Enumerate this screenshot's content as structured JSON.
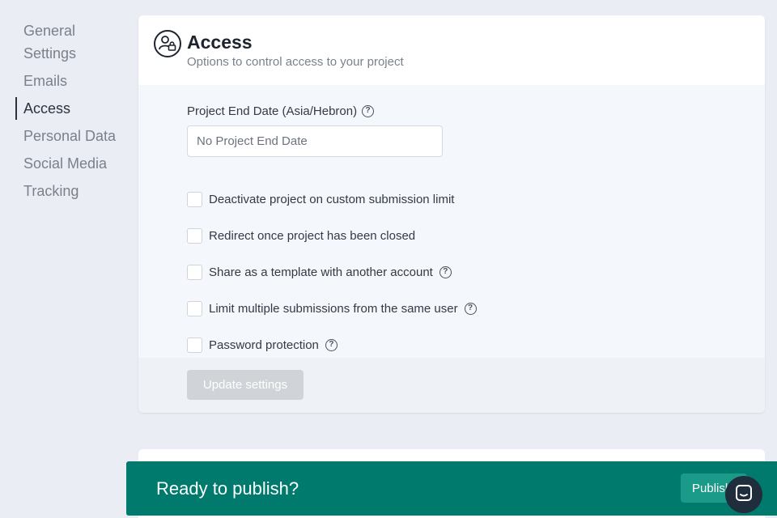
{
  "sidebar": {
    "items": [
      {
        "label": "General Settings"
      },
      {
        "label": "Emails"
      },
      {
        "label": "Access",
        "active": true
      },
      {
        "label": "Personal Data"
      },
      {
        "label": "Social Media"
      },
      {
        "label": "Tracking"
      }
    ]
  },
  "access": {
    "icon": "user-lock-icon",
    "title": "Access",
    "subtitle": "Options to control access to your project",
    "end_date": {
      "label": "Project End Date (Asia/Hebron)",
      "placeholder": "No Project End Date",
      "value": ""
    },
    "options": [
      {
        "label": "Deactivate project on custom submission limit",
        "checked": false,
        "help": false
      },
      {
        "label": "Redirect once project has been closed",
        "checked": false,
        "help": false
      },
      {
        "label": "Share as a template with another account",
        "checked": false,
        "help": true
      },
      {
        "label": "Limit multiple submissions from the same user",
        "checked": false,
        "help": true
      },
      {
        "label": "Password protection",
        "checked": false,
        "help": true
      }
    ],
    "update_button": "Update settings"
  },
  "publish_bar": {
    "text": "Ready to publish?",
    "button": "Publish"
  },
  "colors": {
    "publish_bar": "#007a6c",
    "publish_button": "#1a9a88",
    "disabled_button": "#d0d4d9",
    "chat_launcher": "#1f2d3d"
  }
}
